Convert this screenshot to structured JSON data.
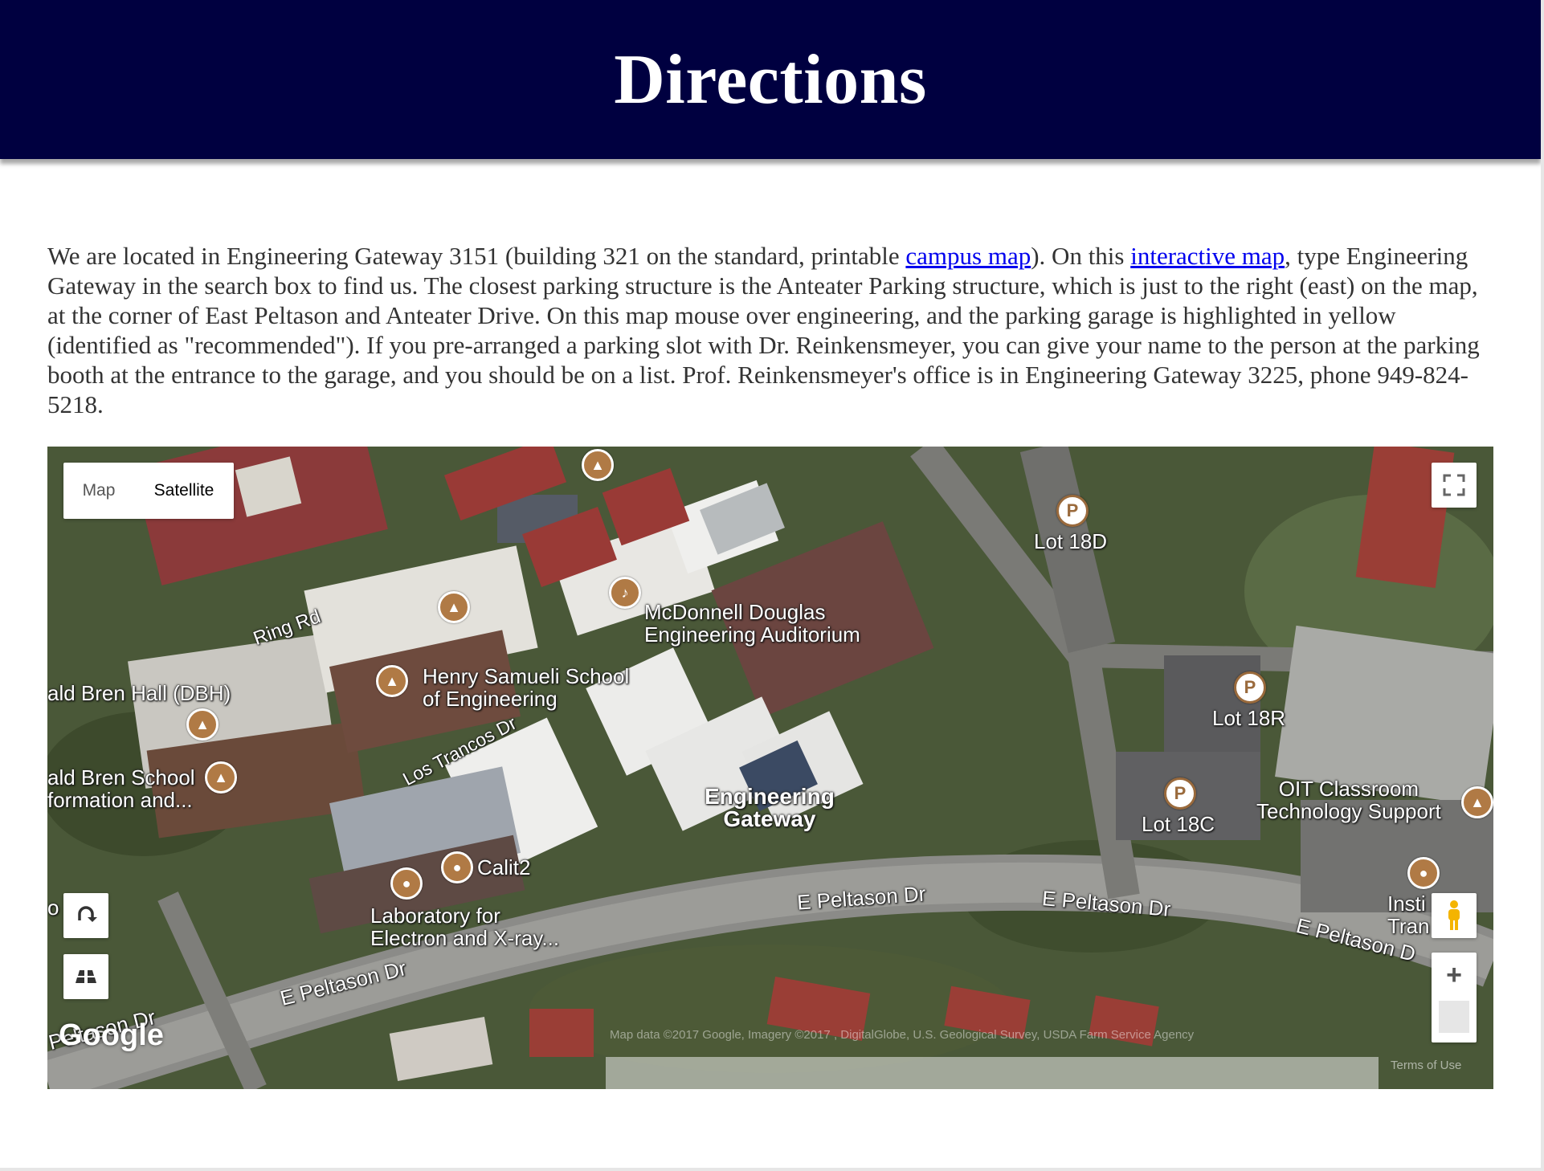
{
  "header": {
    "title": "Directions"
  },
  "intro": {
    "text_1": "We are located in Engineering Gateway 3151 (building 321 on the standard, printable ",
    "link_campus_map": "campus map",
    "text_2": "). On this ",
    "link_interactive_map": "interactive map",
    "text_3": ", type Engineering Gateway in the search box to find us. The closest parking structure is the Anteater Parking structure, which is just to the right (east) on the map, at the corner of East Peltason and Anteater Drive. On this map mouse over engineering, and the parking garage is highlighted in yellow (identified as \"recommended\"). If you pre-arranged a parking slot with Dr. Reinkensmeyer, you can give your name to the person at the parking booth at the entrance to the garage, and you should be on a list. Prof. Reinkensmeyer's office is in Engineering Gateway 3225, phone 949-824-5218."
  },
  "map": {
    "type_control": {
      "map_label": "Map",
      "satellite_label": "Satellite",
      "selected": "Satellite"
    },
    "zoom_in_label": "+",
    "google_logo": "Google",
    "attribution": "Map data ©2017 Google, Imagery ©2017 , DigitalGlobe, U.S. Geological Survey, USDA Farm Service Agency",
    "terms": "Terms of Use",
    "labels": {
      "lot_18d": "Lot 18D",
      "ring_rd": "Ring Rd",
      "mcdonnell_1": "McDonnell Douglas",
      "mcdonnell_2": "Engineering Auditorium",
      "samueli_1": "Henry Samueli School",
      "samueli_2": "of Engineering",
      "dbh": "ald Bren Hall (DBH)",
      "bren_school_1": "ald Bren School",
      "bren_school_2": "formation and...",
      "los_trancos": "Los Trancos Dr",
      "lot_18r": "Lot 18R",
      "oit_1": "OIT Classroom",
      "oit_2": "Technology Support",
      "lot_18c": "Lot 18C",
      "eng_gateway_1": "Engineering",
      "eng_gateway_2": "Gateway",
      "calit2": "Calit2",
      "lab_1": "Laboratory for",
      "lab_2": "Electron and X-ray...",
      "peltason_1": "E Peltason Dr",
      "peltason_2": "E Peltason Dr",
      "peltason_3": "E Peltason D",
      "peltason_4": "E Peltason Dr",
      "peltason_5": "Peltason Dr",
      "institute_1": "Insti",
      "institute_2": "Tran",
      "left_edge": "o"
    },
    "parking_symbol": "P"
  },
  "colors": {
    "header_bg": "#000040",
    "link": "#0000ee",
    "body_text": "#333333",
    "pin": "#b07a45"
  }
}
